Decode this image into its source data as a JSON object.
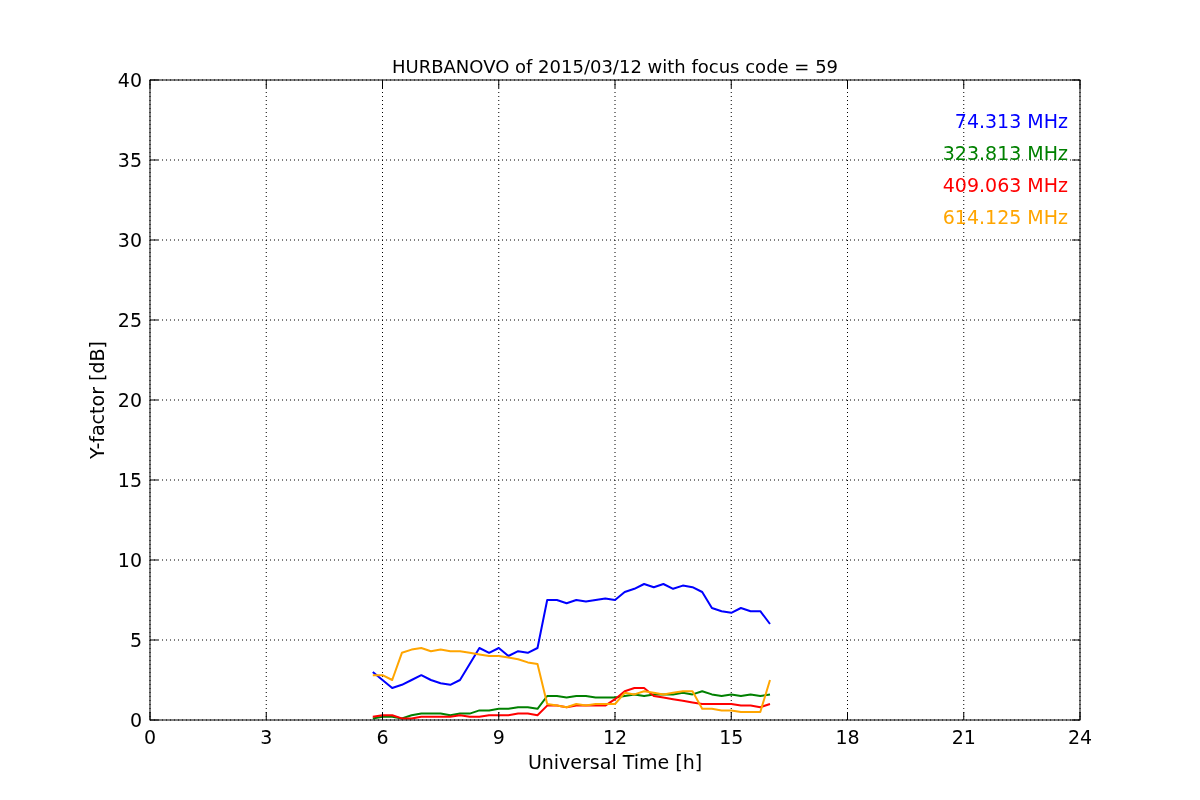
{
  "chart_data": {
    "type": "line",
    "title": "HURBANOVO of 2015/03/12 with focus code = 59",
    "xlabel": "Universal Time [h]",
    "ylabel": "Y-factor [dB]",
    "x": [
      5.75,
      6,
      6.25,
      6.5,
      6.75,
      7,
      7.25,
      7.5,
      7.75,
      8,
      8.25,
      8.5,
      8.75,
      9,
      9.25,
      9.5,
      9.75,
      10,
      10.25,
      10.5,
      10.75,
      11,
      11.25,
      11.5,
      11.75,
      12,
      12.25,
      12.5,
      12.75,
      13,
      13.25,
      13.5,
      13.75,
      14,
      14.25,
      14.5,
      14.75,
      15,
      15.25,
      15.5,
      15.75,
      16
    ],
    "series": [
      {
        "name": "74.313 MHz",
        "color": "#0000ff",
        "values": [
          3,
          2.5,
          2,
          2.2,
          2.5,
          2.8,
          2.5,
          2.3,
          2.2,
          2.5,
          3.5,
          4.5,
          4.2,
          4.5,
          4,
          4.3,
          4.2,
          4.5,
          7.5,
          7.5,
          7.3,
          7.5,
          7.4,
          7.5,
          7.6,
          7.5,
          8,
          8.2,
          8.5,
          8.3,
          8.5,
          8.2,
          8.4,
          8.3,
          8,
          7,
          6.8,
          6.7,
          7,
          6.8,
          6.8,
          6
        ]
      },
      {
        "name": "323.813 MHz",
        "color": "#008000",
        "values": [
          0.1,
          0.2,
          0.2,
          0.1,
          0.3,
          0.4,
          0.4,
          0.4,
          0.3,
          0.4,
          0.4,
          0.6,
          0.6,
          0.7,
          0.7,
          0.8,
          0.8,
          0.7,
          1.5,
          1.5,
          1.4,
          1.5,
          1.5,
          1.4,
          1.4,
          1.4,
          1.5,
          1.6,
          1.5,
          1.6,
          1.6,
          1.6,
          1.7,
          1.6,
          1.8,
          1.6,
          1.5,
          1.6,
          1.5,
          1.6,
          1.5,
          1.6
        ]
      },
      {
        "name": "409.063 MHz",
        "color": "#ff0000",
        "values": [
          0.2,
          0.3,
          0.3,
          0.1,
          0.1,
          0.2,
          0.2,
          0.2,
          0.2,
          0.3,
          0.2,
          0.2,
          0.3,
          0.3,
          0.3,
          0.4,
          0.4,
          0.3,
          0.9,
          0.9,
          0.8,
          0.9,
          0.9,
          0.9,
          0.9,
          1.3,
          1.8,
          2,
          2,
          1.5,
          1.4,
          1.3,
          1.2,
          1.1,
          1,
          1,
          1,
          1,
          0.9,
          0.9,
          0.8,
          1
        ]
      },
      {
        "name": "614.125 MHz",
        "color": "#ffa500",
        "values": [
          2.8,
          2.8,
          2.5,
          4.2,
          4.4,
          4.5,
          4.3,
          4.4,
          4.3,
          4.3,
          4.2,
          4.1,
          4,
          4,
          3.9,
          3.8,
          3.6,
          3.5,
          1,
          0.9,
          0.8,
          1,
          0.9,
          1,
          1,
          1,
          1.7,
          1.6,
          1.8,
          1.7,
          1.6,
          1.7,
          1.8,
          1.8,
          0.7,
          0.7,
          0.6,
          0.6,
          0.5,
          0.5,
          0.5,
          2.5
        ]
      }
    ],
    "grid": true,
    "xlim": [
      0,
      24
    ],
    "ylim": [
      0,
      40
    ],
    "xticks": [
      0,
      3,
      6,
      9,
      12,
      15,
      18,
      21,
      24
    ],
    "yticks": [
      0,
      5,
      10,
      15,
      20,
      25,
      30,
      35,
      40
    ]
  }
}
